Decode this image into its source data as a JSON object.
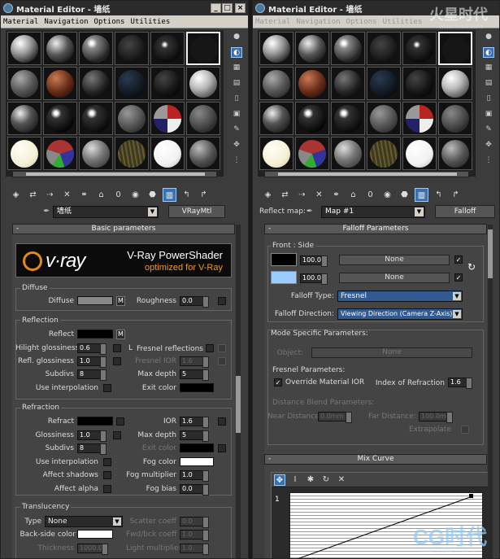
{
  "left": {
    "title": "Material Editor - 墙纸",
    "menus": [
      "Material",
      "Navigation",
      "Options",
      "Utilities"
    ],
    "material_name": "墙纸",
    "material_type": "VRayMtl",
    "rollout_basic": "Basic parameters",
    "banner": {
      "logo": "v·ray",
      "title": "V-Ray PowerShader",
      "subtitle": "optimized for V-Ray"
    },
    "diffuse": {
      "group": "Diffuse",
      "diffuse_label": "Diffuse",
      "m_label": "M",
      "roughness_label": "Roughness",
      "roughness_value": "0.0"
    },
    "reflection": {
      "group": "Reflection",
      "reflect_label": "Reflect",
      "m_label": "M",
      "hilight_label": "Hilight glossiness",
      "hilight_value": "0.6",
      "l_label": "L",
      "fresnel_label": "Fresnel reflections",
      "fresnel_ior_label": "Fresnel IOR",
      "fresnel_ior_value": "1.6",
      "refl_gloss_label": "Refl. glossiness",
      "refl_gloss_value": "1.0",
      "subdivs_label": "Subdivs",
      "subdivs_value": "8",
      "max_depth_label": "Max depth",
      "max_depth_value": "5",
      "use_interp_label": "Use interpolation",
      "exit_color_label": "Exit color"
    },
    "refraction": {
      "group": "Refraction",
      "refract_label": "Refract",
      "ior_label": "IOR",
      "ior_value": "1.6",
      "gloss_label": "Glossiness",
      "gloss_value": "1.0",
      "max_depth_label": "Max depth",
      "max_depth_value": "5",
      "subdivs_label": "Subdivs",
      "subdivs_value": "8",
      "exit_color_label": "Exit color",
      "use_interp_label": "Use interpolation",
      "fog_color_label": "Fog color",
      "affect_shadows_label": "Affect shadows",
      "fog_mult_label": "Fog multiplier",
      "fog_mult_value": "1.0",
      "affect_alpha_label": "Affect alpha",
      "fog_bias_label": "Fog bias",
      "fog_bias_value": "0.0"
    },
    "translucency": {
      "group": "Translucency",
      "type_label": "Type",
      "type_value": "None",
      "scatter_label": "Scatter coeff",
      "scatter_value": "0.0",
      "backside_label": "Back-side color",
      "fwd_label": "Fwd/bck coeff",
      "fwd_value": "1.0",
      "thickness_label": "Thickness",
      "thickness_value": "1000.0",
      "light_mult_label": "Light multiplier",
      "light_mult_value": "1.0"
    }
  },
  "right": {
    "title": "Material Editor - 墙纸",
    "menus": [
      "Material",
      "Navigation",
      "Options",
      "Utilities"
    ],
    "reflect_map_label": "Reflect map:",
    "map_name": "Map #1",
    "map_type": "Falloff",
    "rollout_falloff": "Falloff Parameters",
    "front_side": {
      "group": "Front : Side",
      "value1": "100.0",
      "map1": "None",
      "value2": "100.0",
      "map2": "None",
      "falloff_type_label": "Falloff Type:",
      "falloff_type_value": "Fresnel",
      "falloff_dir_label": "Falloff Direction:",
      "falloff_dir_value": "Viewing Direction (Camera Z-Axis)"
    },
    "mode_specific": {
      "group": "Mode Specific Parameters:",
      "object_label": "Object:",
      "object_value": "None",
      "fresnel_group": "Fresnel Parameters:",
      "override_label": "Override Material IOR",
      "ior_label": "Index of Refraction",
      "ior_value": "1.6",
      "distance_group": "Distance Blend Parameters:",
      "near_label": "Near Distance:",
      "near_value": "0.0mm",
      "far_label": "Far Distance:",
      "far_value": "100.0mm",
      "extrapolate_label": "Extrapolate"
    },
    "rollout_mix": "Mix Curve",
    "curve_point_label": "1"
  },
  "colors": {
    "diffuse_swatch": "#888888",
    "reflect_swatch": "#000000",
    "refract_swatch": "#000000",
    "exit_color_swatch": "#000000",
    "fog_color_swatch": "#ffffff",
    "backside_swatch": "#ffffff",
    "front_swatch": "#000000",
    "side_swatch": "#99ccff",
    "vray_orange": "#f39a1e"
  },
  "watermarks": {
    "top_right": "火星时代",
    "top_right_url": "www.hxsd.com",
    "bottom_right": "CG时代",
    "bottom_right_url": "www.cgtime.com.cn"
  }
}
